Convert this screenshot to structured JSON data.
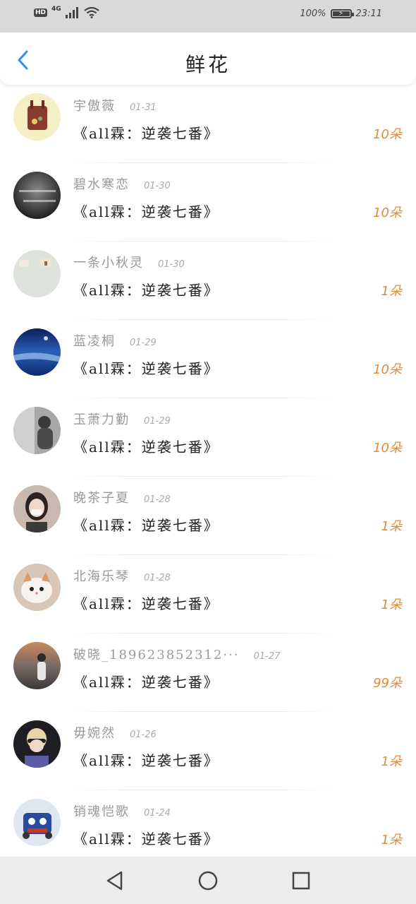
{
  "status_bar": {
    "hd": "HD",
    "network": "4G",
    "battery_text": "100%",
    "battery_level": 1.0,
    "time": "23:11"
  },
  "header": {
    "title": "鲜花",
    "back_icon": "chevron-left-icon"
  },
  "accent_color": "#2f8ef0",
  "count_color": "#e08a3c",
  "items": [
    {
      "name": "宇傲薇",
      "date": "01-31",
      "book": "《all霖：逆袭七番》",
      "count": "10朵"
    },
    {
      "name": "碧水寒恋",
      "date": "01-30",
      "book": "《all霖：逆袭七番》",
      "count": "10朵"
    },
    {
      "name": "一条小秋灵",
      "date": "01-30",
      "book": "《all霖：逆袭七番》",
      "count": "1朵"
    },
    {
      "name": "蓝凌桐",
      "date": "01-29",
      "book": "《all霖：逆袭七番》",
      "count": "10朵"
    },
    {
      "name": "玉萧力勤",
      "date": "01-29",
      "book": "《all霖：逆袭七番》",
      "count": "10朵"
    },
    {
      "name": "晚茶子夏",
      "date": "01-28",
      "book": "《all霖：逆袭七番》",
      "count": "1朵"
    },
    {
      "name": "北海乐琴",
      "date": "01-28",
      "book": "《all霖：逆袭七番》",
      "count": "1朵"
    },
    {
      "name": "破晓_189623852312···",
      "date": "01-27",
      "book": "《all霖：逆袭七番》",
      "count": "99朵"
    },
    {
      "name": "毋婉然",
      "date": "01-26",
      "book": "《all霖：逆袭七番》",
      "count": "1朵"
    },
    {
      "name": "销魂恺歌",
      "date": "01-24",
      "book": "《all霖：逆袭七番》",
      "count": "1朵"
    }
  ],
  "nav": {
    "back": "triangle-back-icon",
    "home": "circle-home-icon",
    "recents": "square-recents-icon"
  }
}
